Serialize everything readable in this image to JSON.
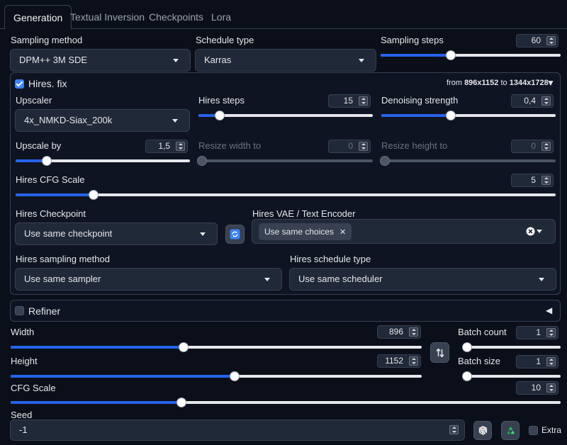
{
  "tabs": [
    {
      "label": "Generation",
      "active": true
    },
    {
      "label": "Textual Inversion",
      "active": false
    },
    {
      "label": "Checkpoints",
      "active": false
    },
    {
      "label": "Lora",
      "active": false
    }
  ],
  "sampling": {
    "method_label": "Sampling method",
    "method_value": "DPM++ 3M SDE",
    "schedule_label": "Schedule type",
    "schedule_value": "Karras",
    "steps_label": "Sampling steps",
    "steps_value": "60",
    "steps_fraction": 0.39
  },
  "hires": {
    "title": "Hires. fix",
    "checked": true,
    "from_prefix": "from",
    "from_size": "896x1152",
    "to_prefix": "to",
    "to_size": "1344x1728",
    "collapse_glyph": "▼",
    "upscaler_label": "Upscaler",
    "upscaler_value": "4x_NMKD-Siax_200k",
    "steps_label": "Hires steps",
    "steps_value": "15",
    "steps_fraction": 0.12,
    "denoise_label": "Denoising strength",
    "denoise_value": "0,4",
    "denoise_fraction": 0.4,
    "upscale_by_label": "Upscale by",
    "upscale_by_value": "1,5",
    "upscale_by_fraction": 0.18,
    "resize_width_label": "Resize width to",
    "resize_width_value": "0",
    "resize_height_label": "Resize height to",
    "resize_height_value": "0",
    "cfg_label": "Hires CFG Scale",
    "cfg_value": "5",
    "cfg_fraction": 0.145,
    "checkpoint_label": "Hires Checkpoint",
    "checkpoint_value": "Use same checkpoint",
    "vae_label": "Hires VAE / Text Encoder",
    "vae_chip": "Use same choices",
    "sampler_label": "Hires sampling method",
    "sampler_value": "Use same sampler",
    "scheduler_label": "Hires schedule type",
    "scheduler_value": "Use same scheduler"
  },
  "refiner": {
    "title": "Refiner",
    "checked": false,
    "collapse_glyph": "◀"
  },
  "size": {
    "width_label": "Width",
    "width_value": "896",
    "width_fraction": 0.42,
    "height_label": "Height",
    "height_value": "1152",
    "height_fraction": 0.545,
    "batch_count_label": "Batch count",
    "batch_count_value": "1",
    "batch_count_fraction": 0.0,
    "batch_size_label": "Batch size",
    "batch_size_value": "1",
    "batch_size_fraction": 0.0
  },
  "cfg": {
    "label": "CFG Scale",
    "value": "10",
    "fraction": 0.31
  },
  "seed": {
    "label": "Seed",
    "value": "-1",
    "extra_label": "Extra"
  },
  "colors": {
    "background": "#0b0f19",
    "accent": "#2563eb",
    "checkbox": "#3b82f6",
    "recycle": "#22c55e"
  },
  "icons": {
    "swap": "swap-dimensions-icon",
    "refresh": "refresh-icon",
    "dice": "dice-icon",
    "recycle": "recycle-icon"
  }
}
